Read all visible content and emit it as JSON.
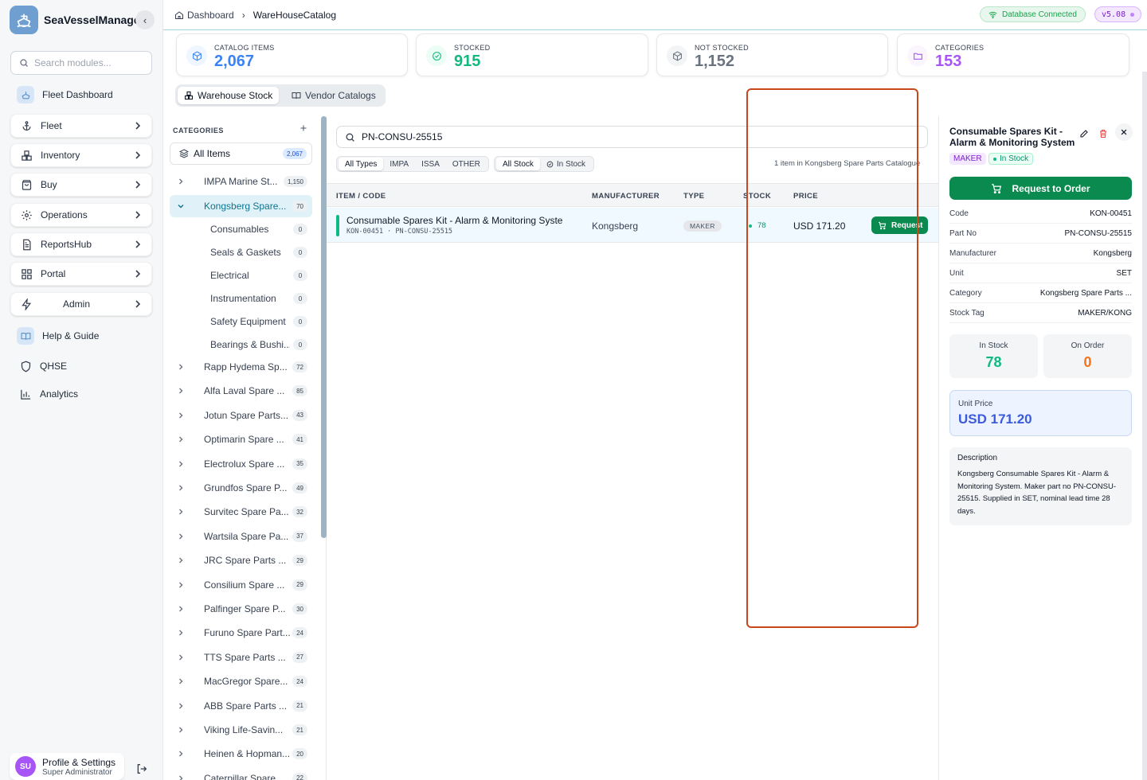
{
  "app": {
    "name": "SeaVesselManager"
  },
  "sidebar": {
    "search_placeholder": "Search modules...",
    "items": [
      {
        "label": "Fleet Dashboard"
      },
      {
        "label": "Fleet"
      },
      {
        "label": "Inventory"
      },
      {
        "label": "Buy"
      },
      {
        "label": "Operations"
      },
      {
        "label": "ReportsHub"
      },
      {
        "label": "Portal"
      },
      {
        "label": "Admin"
      },
      {
        "label": "Help & Guide"
      },
      {
        "label": "QHSE"
      },
      {
        "label": "Analytics"
      }
    ],
    "profile": {
      "initials": "SU",
      "name": "Profile & Settings",
      "role": "Super Administrator"
    }
  },
  "topbar": {
    "breadcrumb": [
      "Dashboard",
      "WareHouseCatalog"
    ],
    "db_status": "Database Connected",
    "version": "v5.08"
  },
  "stats": [
    {
      "label": "CATALOG ITEMS",
      "value": "2,067",
      "color": "#3b82f6"
    },
    {
      "label": "STOCKED",
      "value": "915",
      "color": "#10b981"
    },
    {
      "label": "NOT STOCKED",
      "value": "1,152",
      "color": "#6b7280"
    },
    {
      "label": "CATEGORIES",
      "value": "153",
      "color": "#a855f7"
    }
  ],
  "tabs": [
    {
      "label": "Warehouse Stock"
    },
    {
      "label": "Vendor Catalogs"
    }
  ],
  "categories": {
    "header": "CATEGORIES",
    "all_items": {
      "label": "All Items",
      "count": "2,067"
    },
    "list": [
      {
        "name": "IMPA Marine St...",
        "count": "1,150"
      },
      {
        "name": "Kongsberg Spare...",
        "count": "70"
      },
      {
        "name": "Rapp Hydema Sp...",
        "count": "72"
      },
      {
        "name": "Alfa Laval Spare ...",
        "count": "85"
      },
      {
        "name": "Jotun Spare Parts...",
        "count": "43"
      },
      {
        "name": "Optimarin Spare ...",
        "count": "41"
      },
      {
        "name": "Electrolux Spare ...",
        "count": "35"
      },
      {
        "name": "Grundfos Spare P...",
        "count": "49"
      },
      {
        "name": "Survitec Spare Pa...",
        "count": "32"
      },
      {
        "name": "Wartsila Spare Pa...",
        "count": "37"
      },
      {
        "name": "JRC Spare Parts ...",
        "count": "29"
      },
      {
        "name": "Consilium Spare ...",
        "count": "29"
      },
      {
        "name": "Palfinger Spare P...",
        "count": "30"
      },
      {
        "name": "Furuno Spare Part...",
        "count": "24"
      },
      {
        "name": "TTS Spare Parts ...",
        "count": "27"
      },
      {
        "name": "MacGregor Spare...",
        "count": "24"
      },
      {
        "name": "ABB Spare Parts ...",
        "count": "21"
      },
      {
        "name": "Viking Life-Savin...",
        "count": "21"
      },
      {
        "name": "Heinen & Hopman...",
        "count": "20"
      },
      {
        "name": "Caterpillar Spare ...",
        "count": "22"
      }
    ],
    "subs": [
      {
        "name": "Consumables",
        "count": "0"
      },
      {
        "name": "Seals & Gaskets",
        "count": "0"
      },
      {
        "name": "Electrical",
        "count": "0"
      },
      {
        "name": "Instrumentation",
        "count": "0"
      },
      {
        "name": "Safety Equipment",
        "count": "0"
      },
      {
        "name": "Bearings & Bushi...",
        "count": "0"
      }
    ]
  },
  "main": {
    "search_value": "PN-CONSU-25515",
    "type_filters": [
      "All Types",
      "IMPA",
      "ISSA",
      "OTHER"
    ],
    "stock_filters": [
      "All Stock",
      "In Stock"
    ],
    "result_count": "1 item in Kongsberg Spare Parts Catalogue",
    "columns": [
      "ITEM / CODE",
      "MANUFACTURER",
      "TYPE",
      "STOCK",
      "PRICE"
    ],
    "rows": [
      {
        "name": "Consumable Spares Kit - Alarm & Monitoring Syste",
        "code": "KON-00451  ·  PN-CONSU-25515",
        "manufacturer": "Kongsberg",
        "type": "MAKER",
        "stock": "78",
        "price": "USD 171.20",
        "action": "Request"
      }
    ]
  },
  "detail": {
    "title": "Consumable Spares Kit - Alarm & Monitoring System",
    "tag_type": "MAKER",
    "tag_status": "In Stock",
    "request_label": "Request to Order",
    "fields": [
      {
        "k": "Code",
        "v": "KON-00451"
      },
      {
        "k": "Part No",
        "v": "PN-CONSU-25515"
      },
      {
        "k": "Manufacturer",
        "v": "Kongsberg"
      },
      {
        "k": "Unit",
        "v": "SET"
      },
      {
        "k": "Category",
        "v": "Kongsberg Spare Parts ..."
      },
      {
        "k": "Stock Tag",
        "v": "MAKER/KONG"
      }
    ],
    "in_stock": {
      "label": "In Stock",
      "value": "78"
    },
    "on_order": {
      "label": "On Order",
      "value": "0"
    },
    "unit_price": {
      "label": "Unit Price",
      "value": "USD 171.20"
    },
    "description": {
      "label": "Description",
      "text": "Kongsberg Consumable Spares Kit - Alarm & Monitoring System. Maker part no PN-CONSU-25515. Supplied in SET, nominal lead time 28 days."
    }
  }
}
